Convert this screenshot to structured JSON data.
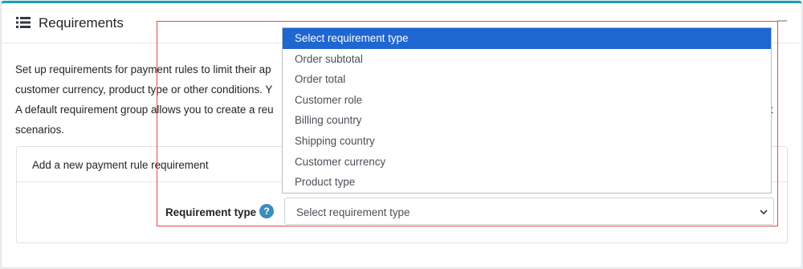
{
  "card": {
    "title": "Requirements",
    "icon": "list-icon",
    "description_lines": [
      "Set up requirements for payment rules to limit their ap",
      "customer currency, product type or other conditions. Y",
      "A default requirement group allows you to create a reu",
      "scenarios."
    ],
    "description_trailing": "ent"
  },
  "inner_card": {
    "title": "Add a new payment rule requirement",
    "field_label": "Requirement type",
    "help_icon": "?",
    "select": {
      "value": "Select requirement type",
      "options": [
        "Select requirement type",
        "Order subtotal",
        "Order total",
        "Customer role",
        "Billing country",
        "Shipping country",
        "Customer currency",
        "Product type"
      ],
      "selected_index": 0
    }
  },
  "colors": {
    "accent_top_border": "#17a2b8",
    "selected_option_bg": "#1e66d0",
    "help_icon_bg": "#3c8dbc",
    "highlight_frame": "#e04a4a"
  }
}
